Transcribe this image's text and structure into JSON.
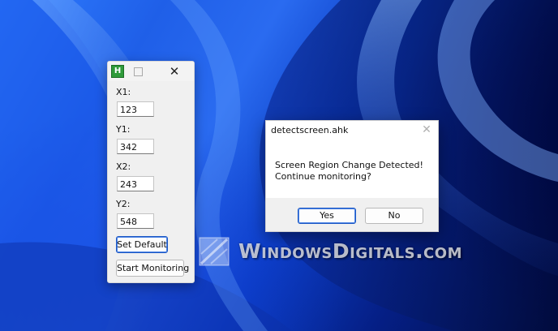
{
  "ahk_window": {
    "app_icon_letter": "H",
    "close_glyph": "✕",
    "fields": [
      {
        "label": "X1:",
        "value": "123"
      },
      {
        "label": "Y1:",
        "value": "342"
      },
      {
        "label": "X2:",
        "value": "243"
      },
      {
        "label": "Y2:",
        "value": "548"
      }
    ],
    "set_default_label": "Set Default",
    "start_monitoring_label": "Start Monitoring"
  },
  "msgbox": {
    "title": "detectscreen.ahk",
    "close_glyph": "✕",
    "message_line1": "Screen Region Change Detected!",
    "message_line2": "Continue monitoring?",
    "yes_label": "Yes",
    "no_label": "No"
  },
  "watermark": {
    "text": "WindowsDigitals.com"
  },
  "colors": {
    "accent_focus_border": "#1b57c4",
    "app_icon_green": "#2f9b3a",
    "desktop_blue": "#1f5fe8"
  },
  "icons": {
    "app_icon": "autohotkey-icon",
    "maximize": "maximize-icon",
    "close": "close-icon",
    "watermark_logo": "windows-logo-icon"
  }
}
